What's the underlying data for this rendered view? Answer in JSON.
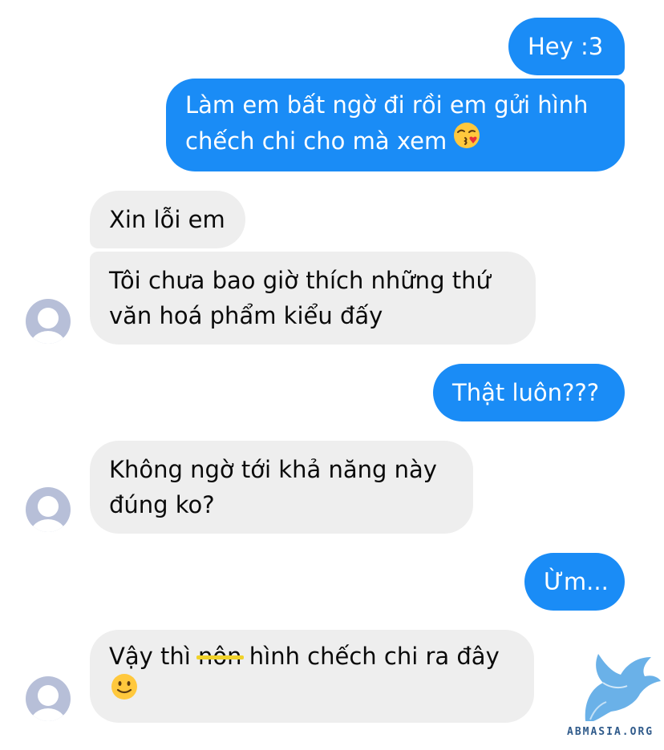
{
  "conversation": {
    "messages": [
      {
        "sender": "me",
        "lines": [
          "Hey :3"
        ]
      },
      {
        "sender": "me",
        "lines": [
          "Làm em bất ngờ đi rồi em gửi hình",
          "chếch chi cho mà xem"
        ],
        "emoji": "face-blowing-kiss"
      },
      {
        "sender": "other",
        "lines": [
          "Xin lỗi em"
        ]
      },
      {
        "sender": "other",
        "lines": [
          "Tôi chưa bao giờ thích những thứ",
          "văn hoá phẩm kiểu đấy"
        ]
      },
      {
        "sender": "me",
        "lines": [
          "Thật luôn???"
        ]
      },
      {
        "sender": "other",
        "lines": [
          "Không ngờ tới khả năng này",
          "đúng ko?"
        ]
      },
      {
        "sender": "me",
        "lines": [
          "Ừm..."
        ]
      },
      {
        "sender": "other",
        "lines_parts": [
          "Vậy thì",
          "nôn",
          "hình chếch chi ra đây"
        ],
        "struck_word": "nôn",
        "emoji": "slightly-smiling-face"
      }
    ]
  },
  "watermark": {
    "text": "ABMASIA.ORG",
    "icon": "blue-griffin-logo"
  },
  "colors": {
    "outgoing_bubble": "#1a8cf6",
    "incoming_bubble": "#eeeeee",
    "strike_highlight": "#f0d22a",
    "avatar_placeholder": "#b7bfd8"
  }
}
